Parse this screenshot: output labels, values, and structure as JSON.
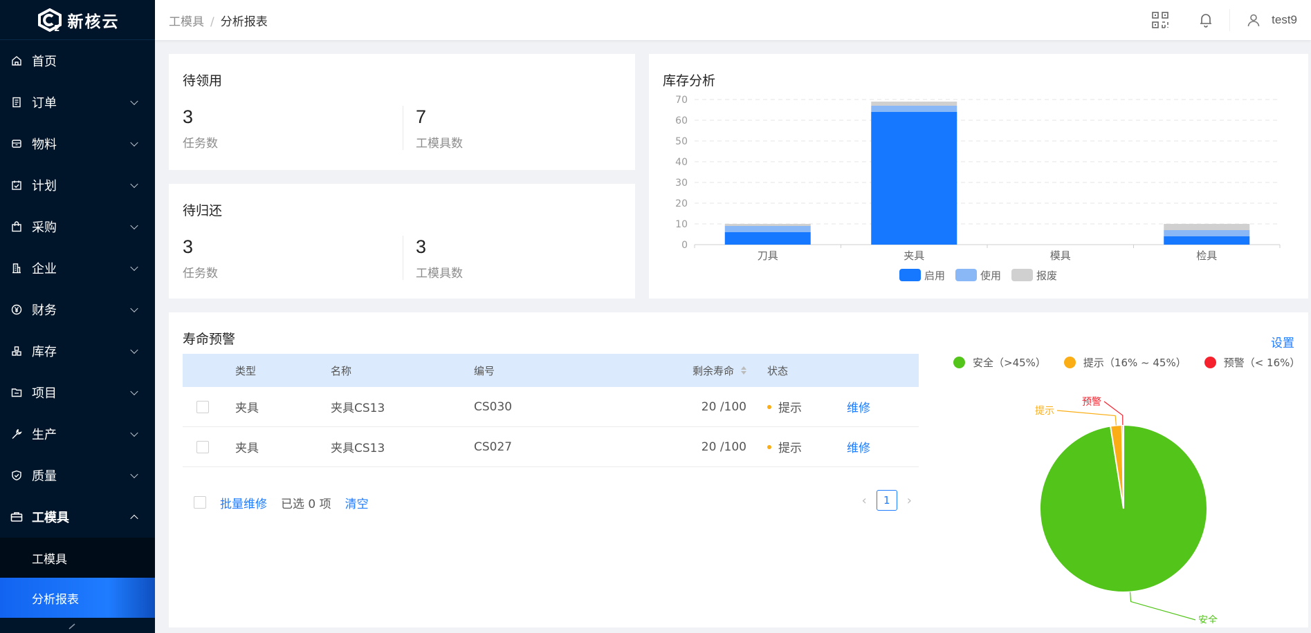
{
  "app": {
    "name": "新核云"
  },
  "sidebar": {
    "items": [
      {
        "label": "首页",
        "icon": "home-icon",
        "expandable": false
      },
      {
        "label": "订单",
        "icon": "document-icon",
        "expandable": true
      },
      {
        "label": "物料",
        "icon": "box-icon",
        "expandable": true
      },
      {
        "label": "计划",
        "icon": "calendar-check-icon",
        "expandable": true
      },
      {
        "label": "采购",
        "icon": "shopping-bag-icon",
        "expandable": true
      },
      {
        "label": "企业",
        "icon": "building-icon",
        "expandable": true
      },
      {
        "label": "财务",
        "icon": "yen-icon",
        "expandable": true
      },
      {
        "label": "库存",
        "icon": "inventory-icon",
        "expandable": true
      },
      {
        "label": "项目",
        "icon": "folder-icon",
        "expandable": true
      },
      {
        "label": "生产",
        "icon": "wrench-icon",
        "expandable": true
      },
      {
        "label": "质量",
        "icon": "shield-check-icon",
        "expandable": true
      },
      {
        "label": "工模具",
        "icon": "toolbox-icon",
        "expandable": true,
        "open": true
      }
    ],
    "submenu": [
      {
        "label": "工模具",
        "active": false
      },
      {
        "label": "分析报表",
        "active": true
      }
    ],
    "collapse_icon": "collapse-arrow-icon"
  },
  "header": {
    "breadcrumb": [
      "工模具",
      "/",
      "分析报表"
    ],
    "icons": [
      "qrcode-icon",
      "bell-icon",
      "user-icon"
    ],
    "username": "test9"
  },
  "pending_receive": {
    "title": "待领用",
    "tasks": {
      "value": "3",
      "label": "任务数"
    },
    "tools": {
      "value": "7",
      "label": "工模具数"
    }
  },
  "pending_return": {
    "title": "待归还",
    "tasks": {
      "value": "3",
      "label": "任务数"
    },
    "tools": {
      "value": "3",
      "label": "工模具数"
    }
  },
  "inventory": {
    "title": "库存分析"
  },
  "chart_data": [
    {
      "type": "bar",
      "stacked": true,
      "categories": [
        "刀具",
        "夹具",
        "模具",
        "检具"
      ],
      "series": [
        {
          "name": "启用",
          "color": "#1677ff",
          "values": [
            6,
            64,
            0,
            4
          ]
        },
        {
          "name": "使用",
          "color": "#8ab8f7",
          "values": [
            3,
            3,
            0,
            3
          ]
        },
        {
          "name": "报废",
          "color": "#d0d0d0",
          "values": [
            1,
            2,
            0,
            3
          ]
        }
      ],
      "ylim": [
        0,
        70
      ],
      "yticks": [
        "0",
        "10",
        "20",
        "30",
        "40",
        "50",
        "60",
        "70"
      ],
      "grid": true,
      "legend_position": "bottom-center"
    },
    {
      "type": "pie",
      "labels": [
        "安全",
        "提示",
        "预警"
      ],
      "values": [
        97.5,
        2.2,
        0.3
      ],
      "colors": [
        "#52c41a",
        "#faad14",
        "#f5222d"
      ],
      "legend": [
        "安全（>45%）",
        "提示（16% ~ 45%）",
        "预警（< 16%）"
      ],
      "legend_position": "top"
    }
  ],
  "life_warning": {
    "title": "寿命预警",
    "settings_label": "设置",
    "columns": [
      "类型",
      "名称",
      "编号",
      "剩余寿命",
      "状态"
    ],
    "rows": [
      {
        "type": "夹具",
        "name": "夹具CS13",
        "code": "CS030",
        "life": "20 /100",
        "status": "提示",
        "action": "维修"
      },
      {
        "type": "夹具",
        "name": "夹具CS13",
        "code": "CS027",
        "life": "20 /100",
        "status": "提示",
        "action": "维修"
      }
    ],
    "footer": {
      "batch_label": "批量维修",
      "selected_label": "已选 0 项",
      "clear_label": "清空"
    },
    "pagination": {
      "current": "1"
    }
  }
}
